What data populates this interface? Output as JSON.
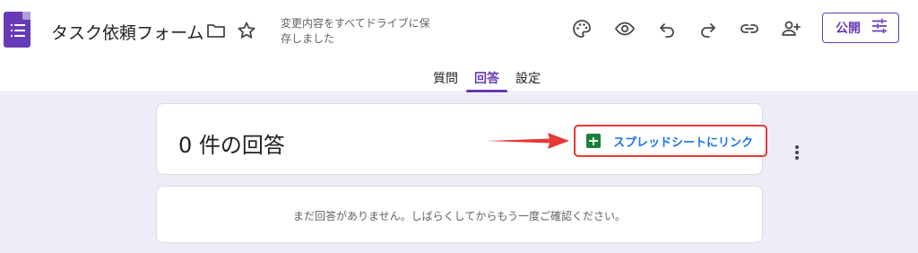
{
  "header": {
    "form_title": "タスク依頼フォーム",
    "save_status": "変更内容をすべてドライブに保存しました",
    "publish_label": "公開",
    "icons": [
      "folder-icon",
      "star-icon",
      "palette-icon",
      "eye-icon",
      "undo-icon",
      "redo-icon",
      "link-icon",
      "add-person-icon",
      "tune-icon"
    ]
  },
  "tabs": [
    {
      "label": "質問",
      "active": false
    },
    {
      "label": "回答",
      "active": true
    },
    {
      "label": "設定",
      "active": false
    }
  ],
  "responses": {
    "count_title": "0 件の回答",
    "sheets_link_label": "スプレッドシートにリンク",
    "empty_message": "まだ回答がありません。しばらくしてからもう一度ご確認ください。"
  },
  "colors": {
    "accent": "#673ab7",
    "background": "#efebf7",
    "link": "#1a73e8",
    "sheets": "#188038",
    "highlight": "#e53935"
  }
}
